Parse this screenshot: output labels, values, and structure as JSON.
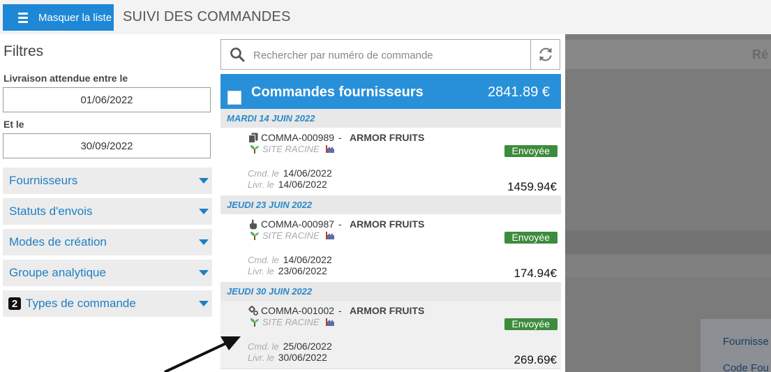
{
  "header": {
    "toggle_label": "Masquer la liste",
    "title": "SUIVI DES COMMANDES"
  },
  "filters": {
    "title": "Filtres",
    "from_label": "Livraison attendue entre le",
    "from_value": "01/06/2022",
    "to_label": "Et le",
    "to_value": "30/09/2022",
    "sections": [
      {
        "label": "Fournisseurs"
      },
      {
        "label": "Statuts d'envois"
      },
      {
        "label": "Modes de création"
      },
      {
        "label": "Groupe analytique"
      },
      {
        "label": "Types de commande",
        "badge": "2"
      }
    ]
  },
  "search": {
    "placeholder": "Rechercher par numéro de commande"
  },
  "orders": {
    "title": "Commandes fournisseurs",
    "total": "2841.89 €",
    "groups": [
      {
        "day": "MARDI 14 JUIN 2022",
        "order": {
          "type_icon": "copy-icon",
          "code": "COMMA-000989",
          "separator": "-",
          "supplier": "ARMOR FRUITS",
          "site": "SITE RACINE",
          "status": "Envoyée",
          "cmd_label": "Cmd. le",
          "cmd_date": "14/06/2022",
          "livr_label": "Livr. le",
          "livr_date": "14/06/2022",
          "amount": "1459.94€"
        }
      },
      {
        "day": "JEUDI 23 JUIN 2022",
        "order": {
          "type_icon": "hand-pointer-icon",
          "code": "COMMA-000987",
          "separator": "-",
          "supplier": "ARMOR FRUITS",
          "site": "SITE RACINE",
          "status": "Envoyée",
          "cmd_label": "Cmd. le",
          "cmd_date": "14/06/2022",
          "livr_label": "Livr. le",
          "livr_date": "23/06/2022",
          "amount": "174.94€"
        }
      },
      {
        "day": "JEUDI 30 JUIN 2022",
        "order": {
          "type_icon": "gears-icon",
          "code": "COMMA-001002",
          "separator": "-",
          "supplier": "ARMOR FRUITS",
          "site": "SITE RACINE",
          "status": "Envoyée",
          "cmd_label": "Cmd. le",
          "cmd_date": "25/06/2022",
          "livr_label": "Livr. le",
          "livr_date": "30/06/2022",
          "amount": "269.69€"
        }
      }
    ]
  },
  "detail": {
    "header_text": "Ré",
    "line1": "Fournisse",
    "line2": "Code Fou"
  },
  "colors": {
    "accent": "#2890d8",
    "status_green": "#3d8b3d",
    "link_blue": "#1f7fc2"
  }
}
